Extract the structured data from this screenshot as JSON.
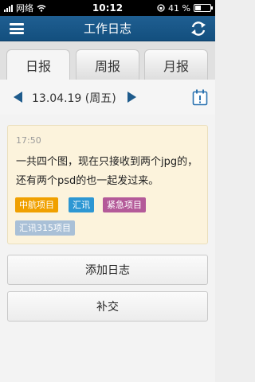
{
  "status_bar": {
    "carrier": "网络",
    "time": "10:12",
    "battery": "41 %",
    "battery_level": 0.41
  },
  "header": {
    "title": "工作日志",
    "menu_icon": "menu-icon",
    "refresh_icon": "refresh-icon"
  },
  "tabs": [
    {
      "label": "日报",
      "active": true
    },
    {
      "label": "周报",
      "active": false
    },
    {
      "label": "月报",
      "active": false
    }
  ],
  "date_nav": {
    "date_text": "13.04.19 (周五)",
    "prev_icon": "triangle-left-icon",
    "next_icon": "triangle-right-icon",
    "calendar_icon": "calendar-icon"
  },
  "log_entry": {
    "time": "17:50",
    "text": "一共四个图，现在只接收到两个jpg的，还有两个psd的也一起发过来。",
    "tags": [
      "中航项目",
      "汇讯",
      "紧急项目",
      "汇讯315项目"
    ]
  },
  "actions": {
    "add_log": "添加日志",
    "supplement": "补交"
  },
  "colors": {
    "header_bg": "#1a5788",
    "card_bg": "#fcf3dc",
    "tag_orange": "#f0a000",
    "tag_blue": "#2d97d3",
    "tag_purple": "#b45a99",
    "tag_light": "#a9c0d7"
  }
}
